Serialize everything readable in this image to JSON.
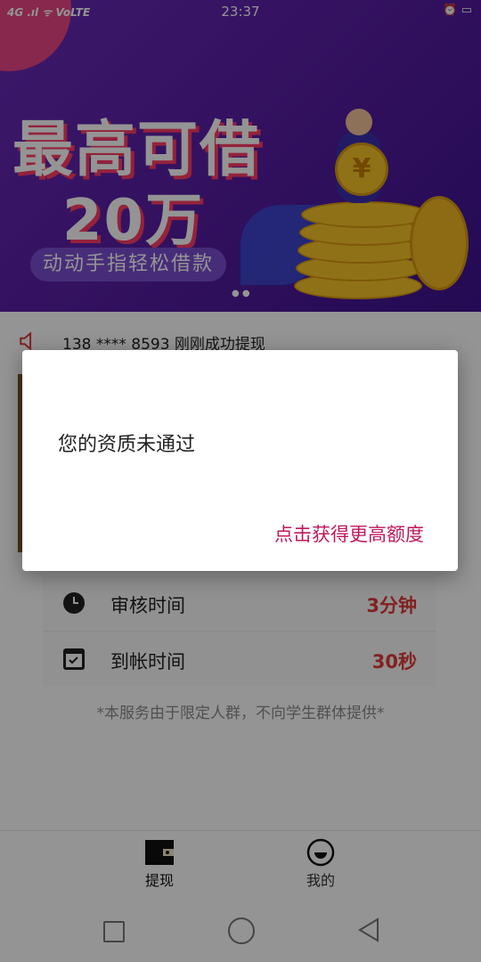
{
  "status_bar": {
    "left": "4G .ıl ᯤ VoLTE",
    "time": "23:37",
    "right": "⏰ ▭"
  },
  "banner": {
    "headline": "最高可借",
    "amount": "20万",
    "tagline": "动动手指轻松借款",
    "coin_symbol": "¥"
  },
  "notice": {
    "text": "138  ****  8593 刚刚成功提现",
    "icon": "speaker-icon"
  },
  "info_rows": [
    {
      "label": "审核时间",
      "value": "3分钟",
      "icon": "clock-icon"
    },
    {
      "label": "到帐时间",
      "value": "30秒",
      "icon": "calendar-check-icon"
    }
  ],
  "disclaimer": "*本服务由于限定人群，不向学生群体提供*",
  "tabs": [
    {
      "label": "提现",
      "icon": "wallet-icon",
      "active": true
    },
    {
      "label": "我的",
      "icon": "smiley-icon",
      "active": false
    }
  ],
  "dialog": {
    "message": "您的资质未通过",
    "action": "点击获得更高额度"
  },
  "colors": {
    "banner_purple": "#5a1fa6",
    "accent_red": "#e03a3a",
    "dialog_action": "#c2185b"
  }
}
